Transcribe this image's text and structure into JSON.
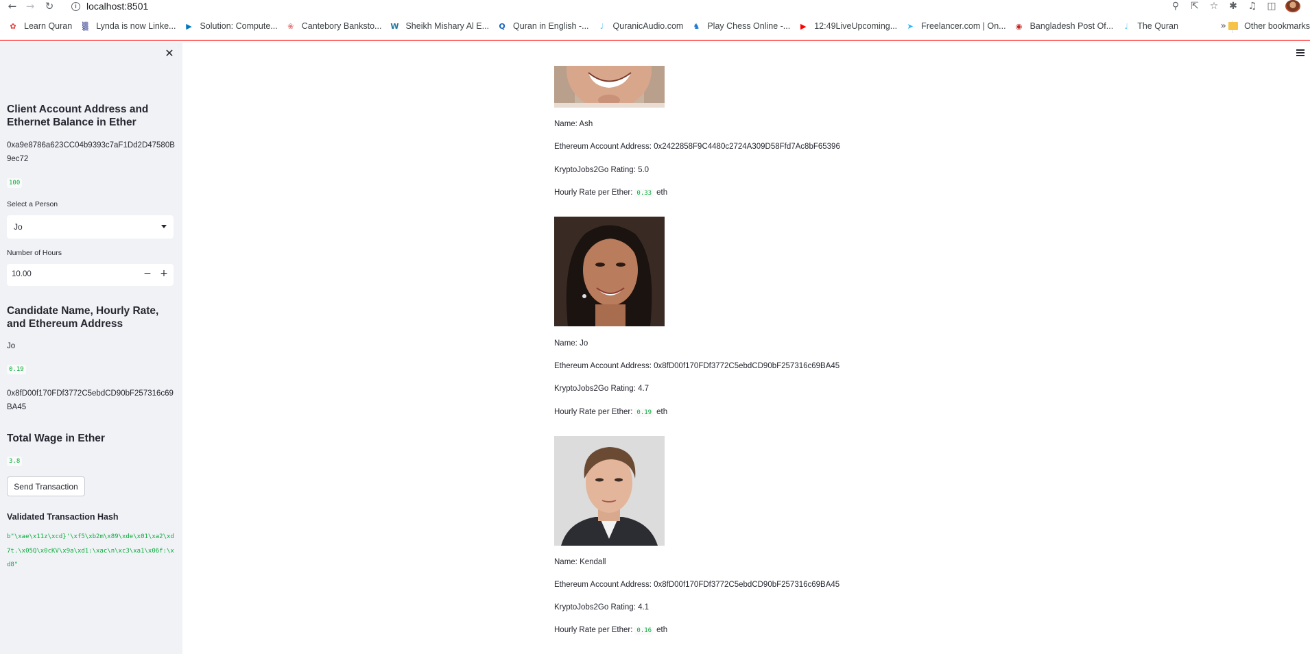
{
  "browser": {
    "url": "localhost:8501",
    "bookmarks": [
      {
        "label": "Learn Quran",
        "icon": "learn-quran-icon",
        "color": "#e53935",
        "glyph": "✿"
      },
      {
        "label": "Lynda is now Linke...",
        "icon": "lynda-icon",
        "color": "#1a237e",
        "glyph": "▒"
      },
      {
        "label": "Solution: Compute...",
        "icon": "play-video-icon",
        "color": "#0277bd",
        "glyph": "▶"
      },
      {
        "label": "Cantebory Banksto...",
        "icon": "canterbury-icon",
        "color": "#e57373",
        "glyph": "❀"
      },
      {
        "label": "Sheikh Mishary Al E...",
        "icon": "wordpress-icon",
        "color": "#21759b",
        "glyph": "W"
      },
      {
        "label": "Quran in English -...",
        "icon": "quran-english-icon",
        "color": "#1565c0",
        "glyph": "Q"
      },
      {
        "label": "QuranicAudio.com",
        "icon": "microphone-icon",
        "color": "#4fc3f7",
        "glyph": "♩"
      },
      {
        "label": "Play Chess Online -...",
        "icon": "chess-icon",
        "color": "#1976d2",
        "glyph": "♞"
      },
      {
        "label": "12:49LiveUpcoming...",
        "icon": "youtube-icon",
        "color": "#ff0000",
        "glyph": "▶"
      },
      {
        "label": "Freelancer.com | On...",
        "icon": "freelancer-icon",
        "color": "#29b2fe",
        "glyph": "➤"
      },
      {
        "label": "Bangladesh Post Of...",
        "icon": "bangladesh-post-icon",
        "color": "#c62828",
        "glyph": "◉"
      },
      {
        "label": "The Quran",
        "icon": "microphone-icon",
        "color": "#4fc3f7",
        "glyph": "♩"
      }
    ],
    "other_bookmarks": "Other bookmarks"
  },
  "sidebar": {
    "client_header": "Client Account Address and Ethernet Balance in Ether",
    "client_address": "0xa9e8786a623CC04b9393c7aF1Dd2D47580B9ec72",
    "client_balance": "100",
    "select_label": "Select a Person",
    "select_value": "Jo",
    "hours_label": "Number of Hours",
    "hours_value": "10.00",
    "candidate_header": "Candidate Name, Hourly Rate, and Ethereum Address",
    "candidate_name": "Jo",
    "candidate_rate": "0.19",
    "candidate_address": "0x8fD00f170FDf3772C5ebdCD90bF257316c69BA45",
    "wage_header": "Total Wage in Ether",
    "wage_value": "3.8",
    "send_button": "Send Transaction",
    "hash_header": "Validated Transaction Hash",
    "hash_value": "b\"\\xae\\x11z\\xcd}'\\xf5\\xb2m\\x89\\xde\\x01\\xa2\\xd7t.\\x05Q\\x0cKV\\x9a\\xd1:\\xac\\n\\xc3\\xa1\\x06f:\\xd8\""
  },
  "candidates": [
    {
      "name_line": "Name: Ash",
      "address_line": "Ethereum Account Address: 0x2422858F9C4480c2724A309D58Ffd7Ac8bF65396",
      "rating_line": "KryptoJobs2Go Rating: 5.0",
      "rate_prefix": "Hourly Rate per Ether:",
      "rate": "0.33",
      "rate_unit": "eth"
    },
    {
      "name_line": "Name: Jo",
      "address_line": "Ethereum Account Address: 0x8fD00f170FDf3772C5ebdCD90bF257316c69BA45",
      "rating_line": "KryptoJobs2Go Rating: 4.7",
      "rate_prefix": "Hourly Rate per Ether:",
      "rate": "0.19",
      "rate_unit": "eth"
    },
    {
      "name_line": "Name: Kendall",
      "address_line": "Ethereum Account Address: 0x8fD00f170FDf3772C5ebdCD90bF257316c69BA45",
      "rating_line": "KryptoJobs2Go Rating: 4.1",
      "rate_prefix": "Hourly Rate per Ether:",
      "rate": "0.16",
      "rate_unit": "eth"
    }
  ]
}
